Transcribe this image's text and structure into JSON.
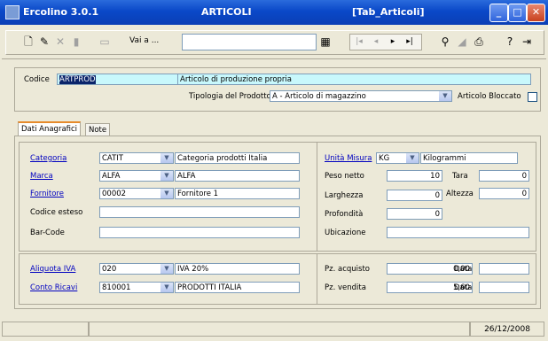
{
  "window": {
    "app_title": "Ercolino 3.0.1",
    "form_title": "ARTICOLI",
    "table_title": "[Tab_Articoli]"
  },
  "toolbar": {
    "goto_label": "Vai a ...",
    "goto_value": ""
  },
  "header": {
    "codice_label": "Codice",
    "codice_value": "ARTPROD",
    "descrizione_value": "Articolo di produzione propria",
    "tipologia_label": "Tipologia del Prodotto",
    "tipologia_value": "A - Articolo di magazzino",
    "bloccato_label": "Articolo Bloccato",
    "bloccato_checked": false
  },
  "tabs": [
    {
      "label": "Dati Anagrafici",
      "active": true
    },
    {
      "label": "Note",
      "active": false
    }
  ],
  "anagrafica": {
    "categoria_label": "Categoria",
    "categoria_code": "CATIT",
    "categoria_desc": "Categoria prodotti Italia",
    "marca_label": "Marca",
    "marca_code": "ALFA",
    "marca_desc": "ALFA",
    "fornitore_label": "Fornitore",
    "fornitore_code": "00002",
    "fornitore_desc": "Fornitore 1",
    "codice_esteso_label": "Codice esteso",
    "codice_esteso_value": "",
    "barcode_label": "Bar-Code",
    "barcode_value": ""
  },
  "misure": {
    "unita_label": "Unità Misura",
    "unita_code": "KG",
    "unita_desc": "Kilogrammi",
    "peso_netto_label": "Peso netto",
    "peso_netto_value": "10",
    "tara_label": "Tara",
    "tara_value": "0",
    "larghezza_label": "Larghezza",
    "larghezza_value": "0",
    "altezza_label": "Altezza",
    "altezza_value": "0",
    "profondita_label": "Profondità",
    "profondita_value": "0",
    "ubicazione_label": "Ubicazione",
    "ubicazione_value": ""
  },
  "fiscale": {
    "aliquota_label": "Aliquota IVA",
    "aliquota_code": "020",
    "aliquota_desc": "IVA 20%",
    "conto_label": "Conto Ricavi",
    "conto_code": "810001",
    "conto_desc": "PRODOTTI ITALIA"
  },
  "prezzi": {
    "acquisto_label": "Pz. acquisto",
    "acquisto_value": "0,00",
    "acquisto_data_label": "Data",
    "acquisto_data_value": "",
    "vendita_label": "Pz. vendita",
    "vendita_value": "5,60",
    "vendita_data_label": "Data",
    "vendita_data_value": ""
  },
  "status": {
    "date": "26/12/2008"
  }
}
